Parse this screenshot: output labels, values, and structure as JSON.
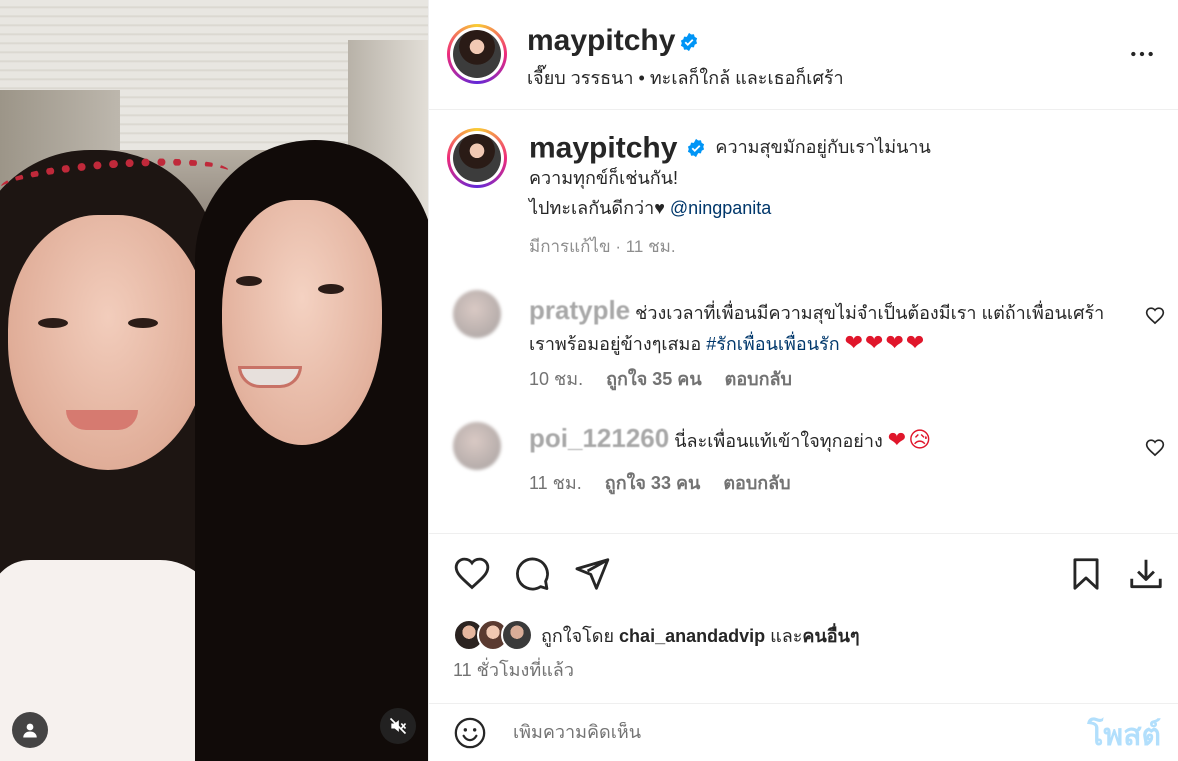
{
  "media": {
    "user_icon": "user-tag-icon",
    "mute_icon": "muted-speaker-icon"
  },
  "header": {
    "username": "maypitchy",
    "subtitle": "เจี๊ยบ วรรธนา • ทะเลก็ใกล้ และเธอก็เศร้า",
    "more_icon": "more-options-icon"
  },
  "caption": {
    "username": "maypitchy",
    "line1": "ความสุขมักอยู่กับเราไม่นาน",
    "line2": "ความทุกข์ก็เช่นกัน!",
    "line3": "ไปทะเลกันดีกว่า♥",
    "mention": "@ningpanita",
    "meta": "มีการแก้ไข · 11 ชม."
  },
  "comments": [
    {
      "username": "pratyple",
      "text": "ช่วงเวลาที่เพื่อนมีความสุขไม่จำเป็นต้องมีเรา แต่ถ้าเพื่อนเศร้าเราพร้อมอยู่ข้างๆเสมอ ",
      "hashtag": "#รักเพื่อนเพื่อนรัก",
      "emoji": "❤❤❤❤",
      "time": "10 ชม.",
      "likes": "ถูกใจ 35 คน",
      "reply": "ตอบกลับ"
    },
    {
      "username": "poi_121260",
      "text": "นี่ละเพื่อนแท้เข้าใจทุกอย่าง",
      "emoji": "❤😥",
      "time": "11 ชม.",
      "likes": "ถูกใจ 33 คน",
      "reply": "ตอบกลับ"
    }
  ],
  "likes": {
    "prefix": "ถูกใจโดย ",
    "user": "chai_anandadvip",
    "middle": " และ",
    "others": "คนอื่นๆ"
  },
  "time_ago": "11 ชั่วโมงที่แล้ว",
  "add_comment": {
    "placeholder": "เพิ่มความคิดเห็น",
    "post_label": "โพสต์"
  },
  "colors": {
    "verified": "#0095f6",
    "mention": "#00376b",
    "post_disabled": "#b2dffc"
  }
}
